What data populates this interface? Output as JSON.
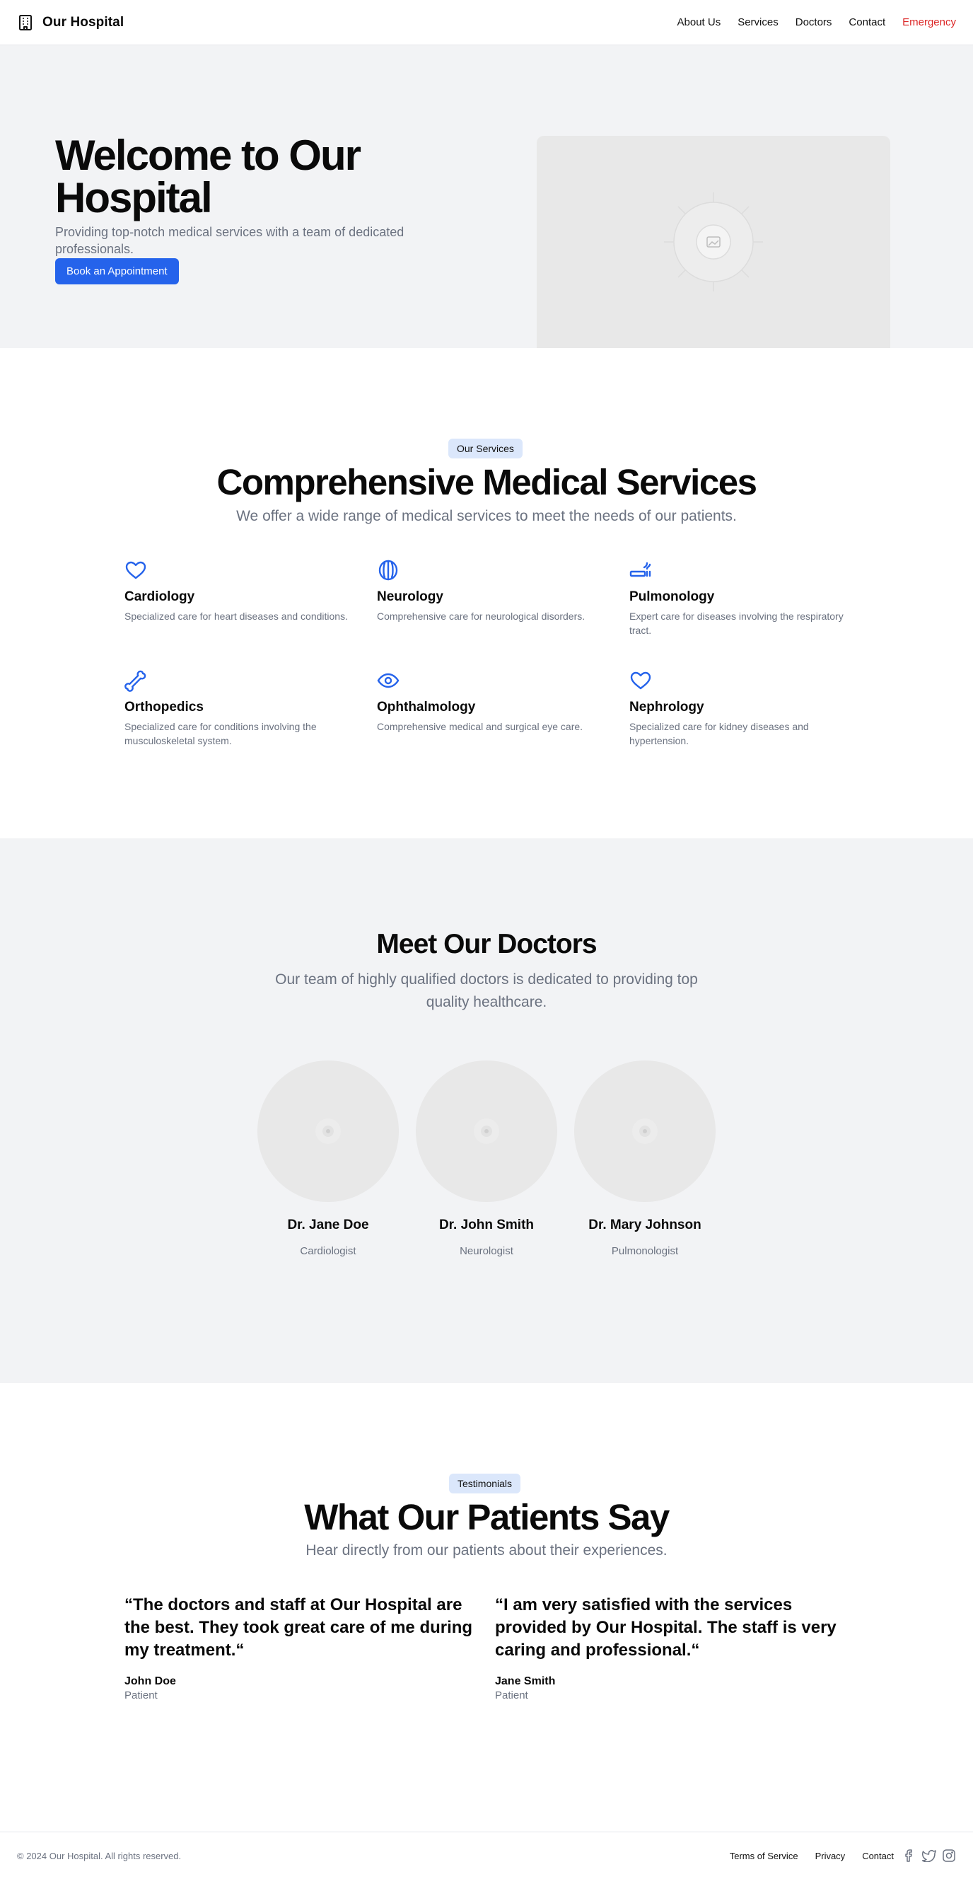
{
  "header": {
    "brand": "Our Hospital",
    "nav": [
      {
        "label": "About Us"
      },
      {
        "label": "Services"
      },
      {
        "label": "Doctors"
      },
      {
        "label": "Contact"
      },
      {
        "label": "Emergency",
        "color": "#dc2626"
      }
    ]
  },
  "hero": {
    "title": "Welcome to Our Hospital",
    "subtitle": "Providing top-notch medical services with a team of dedicated professionals.",
    "cta": "Book an Appointment",
    "image_icon": "image-placeholder-icon"
  },
  "services": {
    "badge": "Our Services",
    "title": "Comprehensive Medical Services",
    "subtitle": "We offer a wide range of medical services to meet the needs of our patients.",
    "items": [
      {
        "name": "Cardiology",
        "desc": "Specialized care for heart diseases and conditions.",
        "icon": "heart-icon"
      },
      {
        "name": "Neurology",
        "desc": "Comprehensive care for neurological disorders.",
        "icon": "brain-icon"
      },
      {
        "name": "Pulmonology",
        "desc": "Expert care for diseases involving the respiratory tract.",
        "icon": "lungs-icon"
      },
      {
        "name": "Orthopedics",
        "desc": "Specialized care for conditions involving the musculoskeletal system.",
        "icon": "bone-icon"
      },
      {
        "name": "Ophthalmology",
        "desc": "Comprehensive medical and surgical eye care.",
        "icon": "eye-icon"
      },
      {
        "name": "Nephrology",
        "desc": "Specialized care for kidney diseases and hypertension.",
        "icon": "heart-icon"
      }
    ]
  },
  "doctors": {
    "title": "Meet Our Doctors",
    "subtitle": "Our team of highly qualified doctors is dedicated to providing top quality healthcare.",
    "items": [
      {
        "name": "Dr. Jane Doe",
        "role": "Cardiologist"
      },
      {
        "name": "Dr. John Smith",
        "role": "Neurologist"
      },
      {
        "name": "Dr. Mary Johnson",
        "role": "Pulmonologist"
      }
    ]
  },
  "testimonials": {
    "badge": "Testimonials",
    "title": "What Our Patients Say",
    "subtitle": "Hear directly from our patients about their experiences.",
    "items": [
      {
        "quote": "“The doctors and staff at Our Hospital are the best. They took great care of me during my treatment.“",
        "name": "John Doe",
        "role": "Patient"
      },
      {
        "quote": "“I am very satisfied with the services provided by Our Hospital. The staff is very caring and professional.“",
        "name": "Jane Smith",
        "role": "Patient"
      }
    ]
  },
  "footer": {
    "copyright": "© 2024 Our Hospital. All rights reserved.",
    "links": [
      {
        "label": "Terms of Service"
      },
      {
        "label": "Privacy"
      },
      {
        "label": "Contact"
      }
    ],
    "social": [
      "facebook-icon",
      "twitter-icon",
      "instagram-icon"
    ]
  },
  "colors": {
    "accent": "#2563eb",
    "emergency": "#dc2626",
    "muted_text": "#6b7280",
    "section_bg": "#f2f3f5",
    "badge_bg": "#dbe7fb"
  }
}
